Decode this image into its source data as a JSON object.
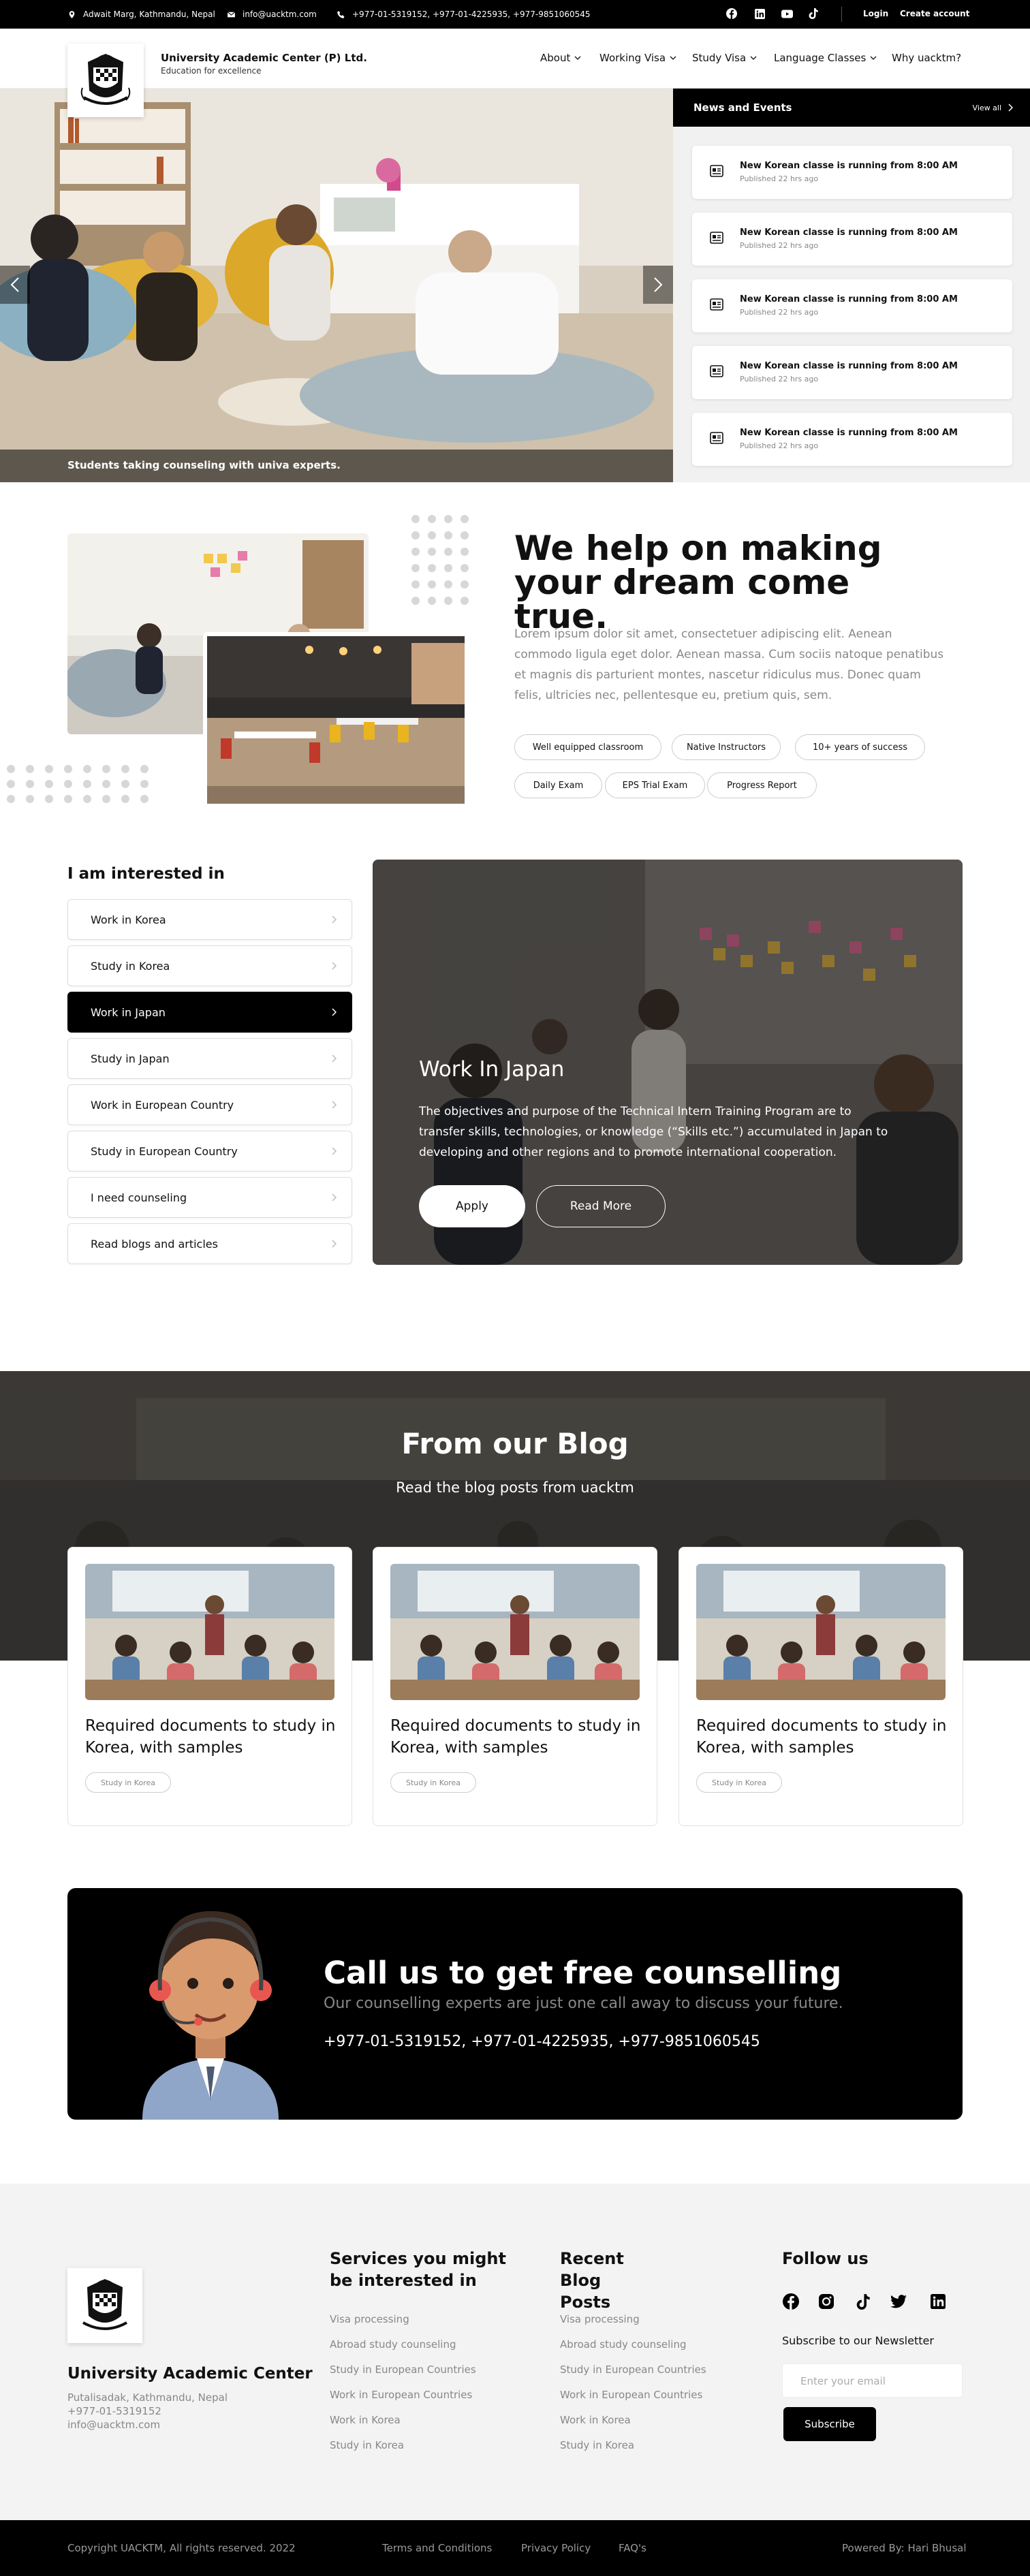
{
  "topbar": {
    "address": "Adwait Marg, Kathmandu, Nepal",
    "email": "info@uacktm.com",
    "phones": "+977-01-5319152, +977-01-4225935, +977-9851060545",
    "login": "Login",
    "create_account": "Create account"
  },
  "header": {
    "brand_name": "University Academic Center (P) Ltd.",
    "tagline": "Education for excellence",
    "nav": [
      {
        "label": "About"
      },
      {
        "label": "Working Visa"
      },
      {
        "label": "Study Visa"
      },
      {
        "label": "Language Classes"
      },
      {
        "label": "Why uacktm?"
      }
    ]
  },
  "hero": {
    "caption": "Students taking counseling with univa experts."
  },
  "news": {
    "title": "News and Events",
    "view_all": "View all",
    "items": [
      {
        "title": "New Korean classe is running from 8:00 AM",
        "published": "Published 22 hrs ago"
      },
      {
        "title": "New Korean classe is running from 8:00 AM",
        "published": "Published 22 hrs ago"
      },
      {
        "title": "New Korean classe is running from 8:00 AM",
        "published": "Published 22 hrs ago"
      },
      {
        "title": "New Korean classe is running from 8:00 AM",
        "published": "Published 22 hrs ago"
      },
      {
        "title": "New Korean classe is running from 8:00 AM",
        "published": "Published 22 hrs ago"
      }
    ]
  },
  "about": {
    "heading": "We help on making your dream come true.",
    "body": "Lorem ipsum dolor sit amet, consectetuer adipiscing elit. Aenean commodo ligula eget dolor. Aenean massa. Cum sociis natoque penatibus et magnis dis parturient montes, nascetur ridiculus mus. Donec quam felis, ultricies nec, pellentesque eu, pretium quis, sem.",
    "features": [
      "Well equipped classroom",
      "Native Instructors",
      "10+ years of success",
      "Daily Exam",
      "EPS Trial Exam",
      "Progress Report"
    ]
  },
  "interest": {
    "heading": "I am interested in",
    "items": [
      "Work in Korea",
      "Study in Korea",
      "Work in Japan",
      "Study in Japan",
      "Work in European Country",
      "Study in European Country",
      "I need counseling",
      "Read blogs and articles"
    ],
    "active_index": 2,
    "panel": {
      "title": "Work In Japan",
      "description": "The objectives and purpose of the Technical Intern Training Program are to transfer skills, technologies, or knowledge (“Skills etc.”) accumulated in Japan to developing and other regions and to promote international cooperation.",
      "apply": "Apply",
      "read_more": "Read More"
    }
  },
  "blog": {
    "heading": "From our Blog",
    "subheading": "Read the blog posts from uacktm",
    "posts": [
      {
        "title": "Required documents to study in Korea, with samples",
        "tag": "Study in Korea"
      },
      {
        "title": "Required documents to study in Korea, with samples",
        "tag": "Study in Korea"
      },
      {
        "title": "Required documents to study in Korea, with samples",
        "tag": "Study in Korea"
      }
    ]
  },
  "cta": {
    "heading": "Call us to get free counselling",
    "subheading": "Our counselling experts are just one call away to discuss your future.",
    "phones": "+977-01-5319152, +977-01-4225935, +977-9851060545"
  },
  "footer": {
    "name": "University Academic Center",
    "address": "Putalisadak, Kathmandu, Nepal",
    "phone": "+977-01-5319152",
    "email": "info@uacktm.com",
    "services_title": "Services you might be interested  in",
    "services": [
      "Visa processing",
      "Abroad study counseling",
      "Study in European Countries",
      "Work in European Countries",
      "Work in Korea",
      "Study in Korea"
    ],
    "recent_title": "Recent Blog Posts",
    "recent": [
      "Visa processing",
      "Abroad study counseling",
      "Study in European Countries",
      "Work in European Countries",
      "Work in Korea",
      "Study in Korea"
    ],
    "follow_title": "Follow us",
    "newsletter_label": "Subscribe to our Newsletter",
    "email_placeholder": "Enter your email",
    "subscribe": "Subscribe"
  },
  "bottom": {
    "copyright": "Copyright UACKTM, All rights reserved. 2022",
    "terms": "Terms and Conditions",
    "privacy": "Privacy Policy",
    "faq": "FAQ's",
    "powered": "Powered By: Hari Bhusal"
  },
  "icons": [
    "location-icon",
    "mail-icon",
    "phone-icon",
    "facebook-icon",
    "linkedin-icon",
    "youtube-icon",
    "tiktok-icon",
    "instagram-icon",
    "twitter-icon",
    "news-icon",
    "chevron-down-icon",
    "chevron-right-icon",
    "chevron-left-icon"
  ]
}
